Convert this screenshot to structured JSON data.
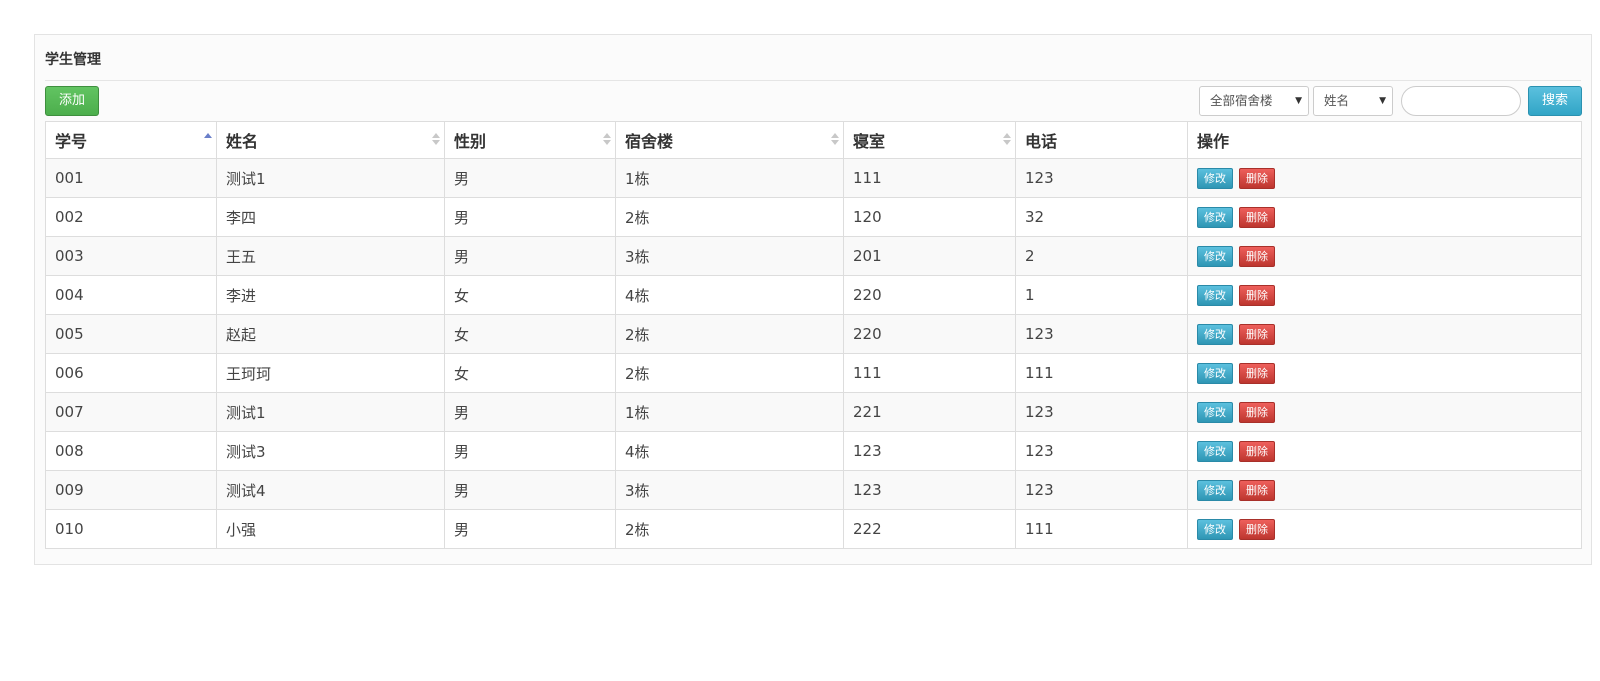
{
  "panel": {
    "title": "学生管理"
  },
  "toolbar": {
    "add_label": "添加",
    "building_select": "全部宿舍楼",
    "field_select": "姓名",
    "search_value": "",
    "search_label": "搜索"
  },
  "table": {
    "columns": [
      "学号",
      "姓名",
      "性别",
      "宿舍楼",
      "寝室",
      "电话",
      "操作"
    ],
    "sort": {
      "column": "学号",
      "direction": "ascending"
    },
    "rows": [
      [
        "001",
        "测试1",
        "男",
        "1栋",
        "111",
        "123"
      ],
      [
        "002",
        "李四",
        "男",
        "2栋",
        "120",
        "32"
      ],
      [
        "003",
        "王五",
        "男",
        "3栋",
        "201",
        "2"
      ],
      [
        "004",
        "李进",
        "女",
        "4栋",
        "220",
        "1"
      ],
      [
        "005",
        "赵起",
        "女",
        "2栋",
        "220",
        "123"
      ],
      [
        "006",
        "王珂珂",
        "女",
        "2栋",
        "111",
        "111"
      ],
      [
        "007",
        "测试1",
        "男",
        "1栋",
        "221",
        "123"
      ],
      [
        "008",
        "测试3",
        "男",
        "4栋",
        "123",
        "123"
      ],
      [
        "009",
        "测试4",
        "男",
        "3栋",
        "123",
        "123"
      ],
      [
        "010",
        "小强",
        "男",
        "2栋",
        "222",
        "111"
      ]
    ],
    "edit_label": "修改",
    "delete_label": "删除"
  },
  "colors": {
    "add_button": "#5cb85c",
    "search_button": "#5bc0de",
    "edit_button": "#49afcd",
    "delete_button": "#da4f49",
    "sort_active": "#6a7fc9"
  },
  "icons": {
    "select_caret": "caret-down-icon",
    "sort": "sort-arrows-icon"
  }
}
